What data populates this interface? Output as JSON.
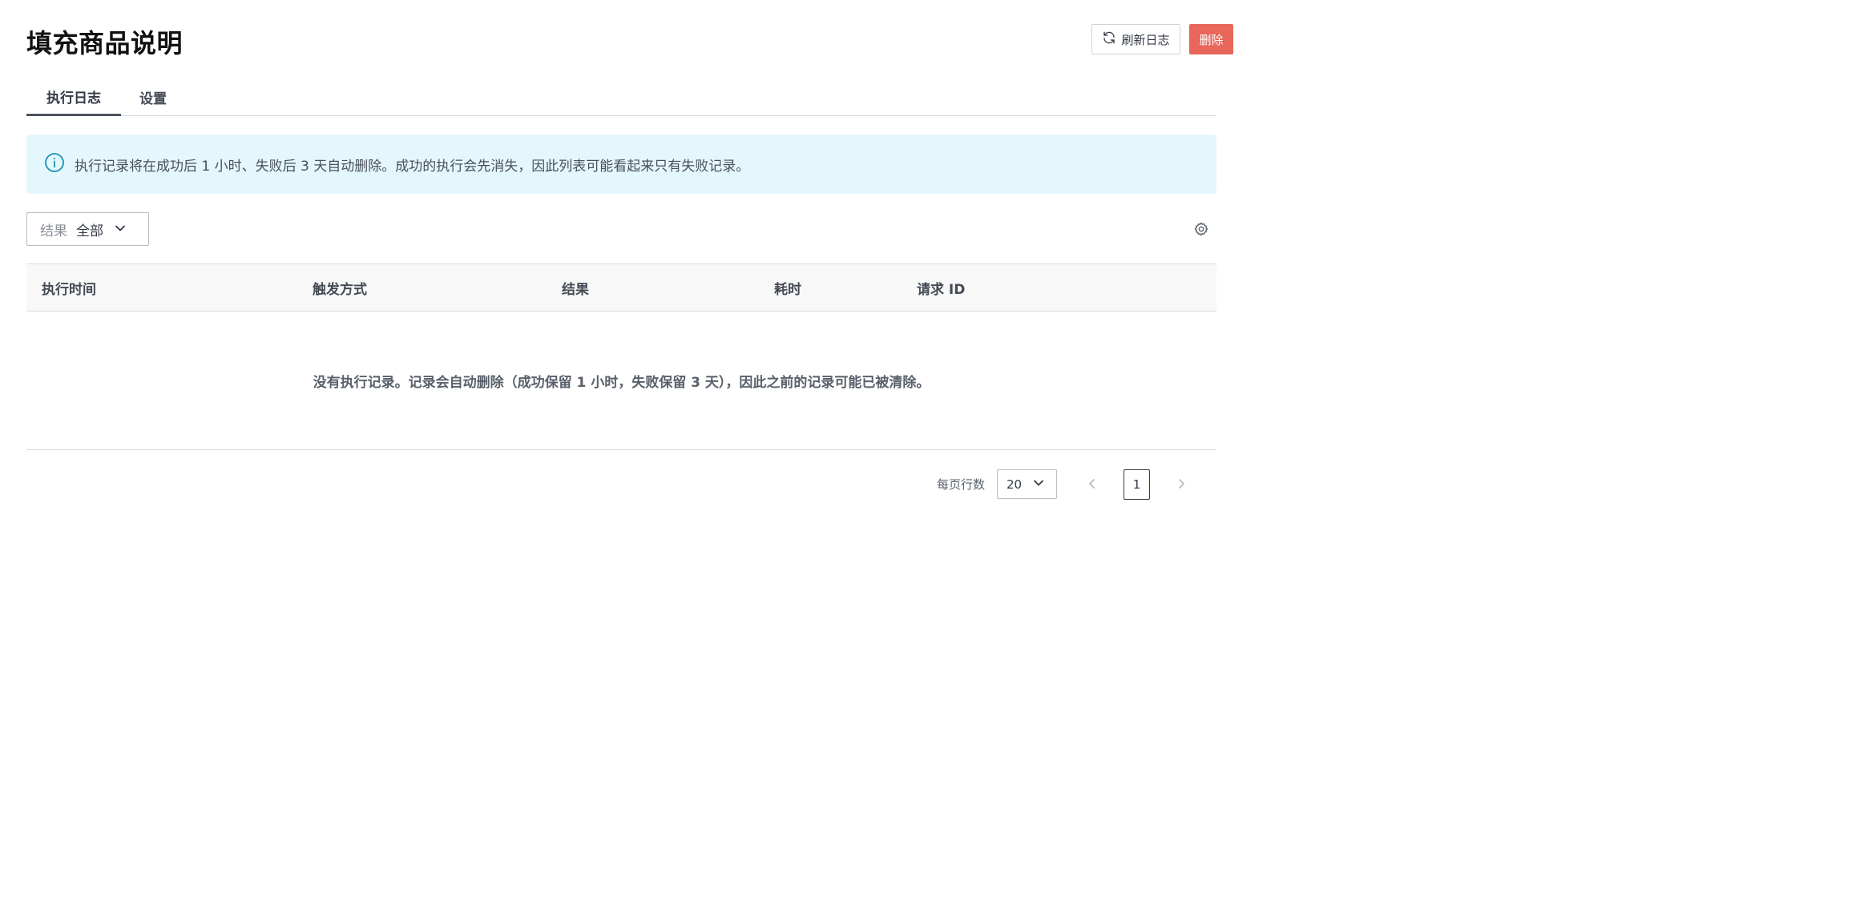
{
  "header": {
    "title": "填充商品说明",
    "refresh_label": "刷新日志",
    "delete_label": "删除"
  },
  "tabs": [
    {
      "label": "执行日志",
      "active": true
    },
    {
      "label": "设置",
      "active": false
    }
  ],
  "banner": {
    "icon": "info-circle-icon",
    "text": "执行记录将在成功后 1 小时、失败后 3 天自动删除。成功的执行会先消失，因此列表可能看起来只有失败记录。"
  },
  "filter": {
    "label": "结果",
    "value": "全部"
  },
  "table": {
    "columns": [
      "执行时间",
      "触发方式",
      "结果",
      "耗时",
      "请求 ID"
    ],
    "rows": [],
    "empty_text": "没有执行记录。记录会自动删除（成功保留 1 小时，失败保留 3 天），因此之前的记录可能已被清除。"
  },
  "pagination": {
    "rows_label": "每页行数",
    "rows_per_page": "20",
    "current_page": "1"
  },
  "colors": {
    "delete": "#e8665a",
    "banner_bg": "#e4f7fd",
    "info_icon": "#1b8fb0"
  }
}
